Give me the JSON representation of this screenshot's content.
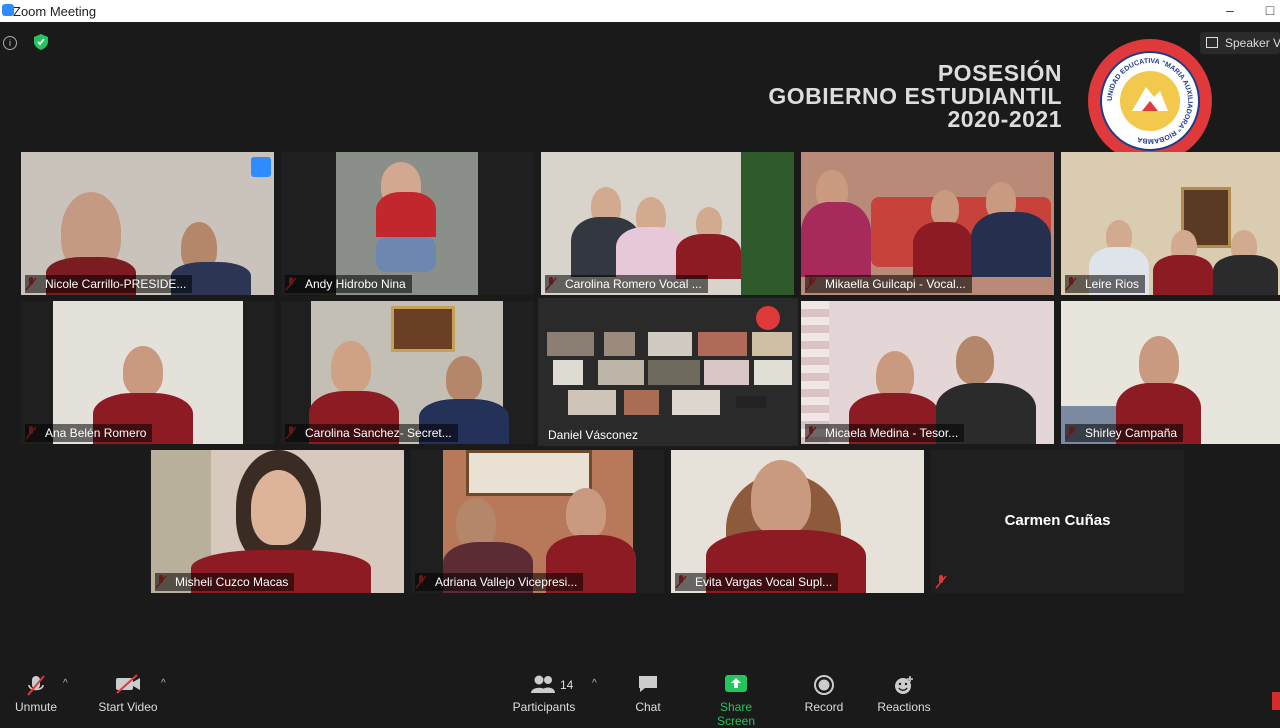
{
  "window": {
    "title": "Zoom Meeting",
    "minimize": "–",
    "maximize": "□"
  },
  "header": {
    "speaker_view": "Speaker View",
    "banner": [
      "POSESIÓN",
      "GOBIERNO ESTUDIANTIL",
      "2020-2021"
    ],
    "seal_text": "UNIDAD EDUCATIVA \"MARIA AUXILIADORA\" RIOBAMBA"
  },
  "participants": [
    {
      "name": "Nicole Carrillo-PRESIDE...",
      "bg": "#c9c3bb"
    },
    {
      "name": "Andy Hidrobo Nina",
      "bg": "#8b8f8a"
    },
    {
      "name": "Carolina Romero Vocal ...",
      "bg": "#d8d4cc"
    },
    {
      "name": "Mikaella Guilcapi - Vocal...",
      "bg": "#b98a78"
    },
    {
      "name": "Leire Rios",
      "bg": "#d9ccb0"
    },
    {
      "name": "Ana Belén Romero",
      "bg": "#e3e1da"
    },
    {
      "name": "Carolina Sanchez- Secret...",
      "bg": "#c4bfb4"
    },
    {
      "name": "Daniel Vásconez",
      "bg": "#2a2a2a"
    },
    {
      "name": "Micaela Medina - Tesor...",
      "bg": "#e4d6d6"
    },
    {
      "name": "Shirley Campaña",
      "bg": "#e8e5dc"
    },
    {
      "name": "Misheli Cuzco Macas",
      "bg": "#d7c9bd"
    },
    {
      "name": "Adriana Vallejo Vicepresi...",
      "bg": "#b8795b"
    },
    {
      "name": "Evita Vargas  Vocal Supl...",
      "bg": "#e7e2d9"
    },
    {
      "name": "Carmen Cuñas",
      "bg": "#1f1f1f"
    }
  ],
  "toolbar": {
    "unmute": "Unmute",
    "start_video": "Start Video",
    "participants": "Participants",
    "participant_count": "14",
    "chat": "Chat",
    "share_screen": "Share Screen",
    "record": "Record",
    "reactions": "Reactions"
  },
  "colors": {
    "share_green": "#22c55e",
    "active_border": "#e6e04a",
    "mic_red": "#e0393b"
  }
}
